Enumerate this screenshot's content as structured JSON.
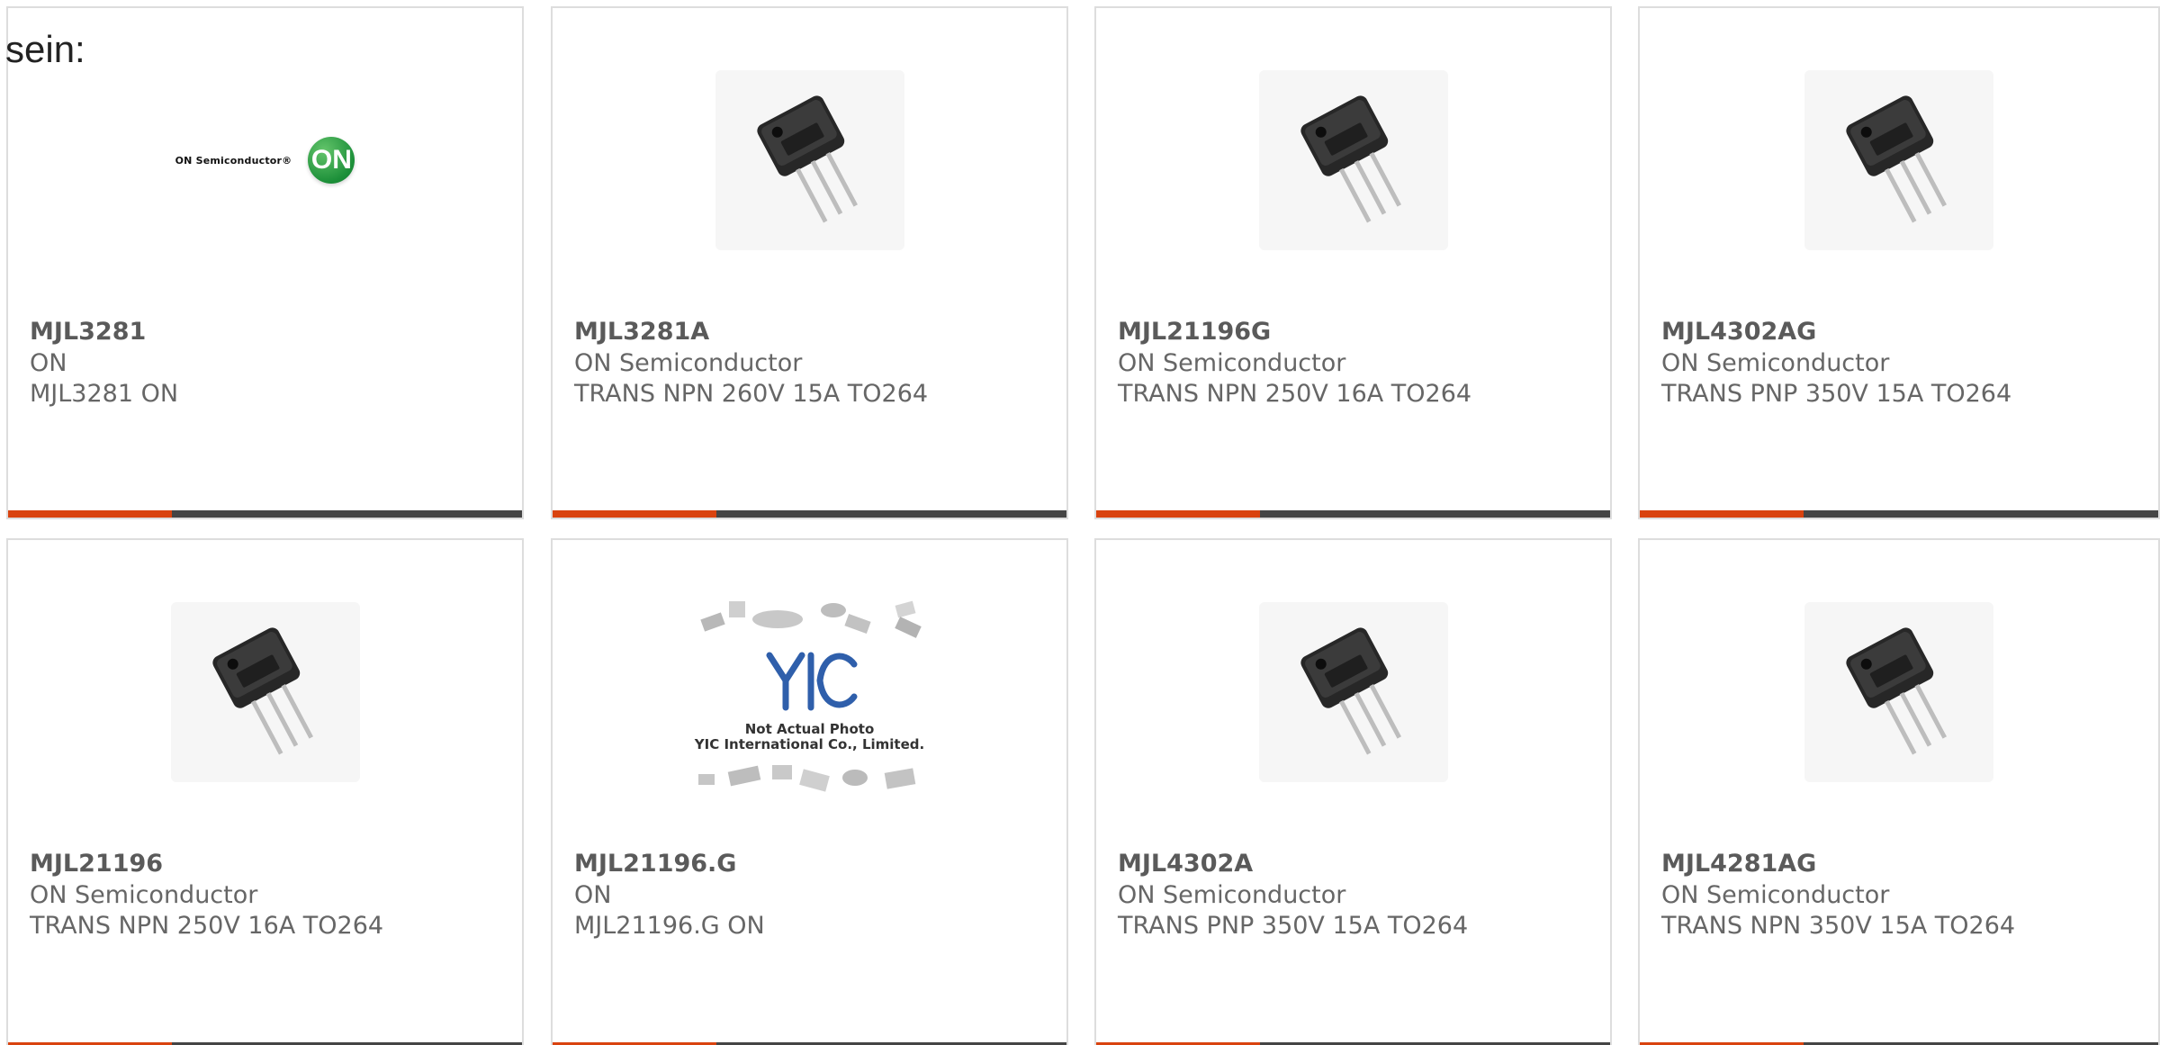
{
  "lead_text": "sein:",
  "colors": {
    "accent_bar": "#d9430f",
    "dark_bar": "#454545",
    "card_border": "#dddddd",
    "on_green": "#1c8f39",
    "yic_blue": "#2f5fab"
  },
  "cards": [
    {
      "part_number": "MJL3281",
      "manufacturer": "ON",
      "description": "MJL3281 ON",
      "thumbnail": "on-semiconductor-logo",
      "logo_text": "ON Semiconductor®",
      "badge_text": "ON"
    },
    {
      "part_number": "MJL3281A",
      "manufacturer": "ON Semiconductor",
      "description": "TRANS NPN 260V 15A TO264",
      "thumbnail": "to264-transistor-icon"
    },
    {
      "part_number": "MJL21196G",
      "manufacturer": "ON Semiconductor",
      "description": "TRANS NPN 250V 16A TO264",
      "thumbnail": "to264-transistor-icon"
    },
    {
      "part_number": "MJL4302AG",
      "manufacturer": "ON Semiconductor",
      "description": "TRANS PNP 350V 15A TO264",
      "thumbnail": "to264-transistor-icon"
    },
    {
      "part_number": "MJL21196",
      "manufacturer": "ON Semiconductor",
      "description": "TRANS NPN 250V 16A TO264",
      "thumbnail": "to264-transistor-icon"
    },
    {
      "part_number": "MJL21196.G",
      "manufacturer": "ON",
      "description": "MJL21196.G ON",
      "thumbnail": "yic-not-actual-photo",
      "caption_line1": "Not Actual Photo",
      "caption_line2": "YIC International Co., Limited."
    },
    {
      "part_number": "MJL4302A",
      "manufacturer": "ON Semiconductor",
      "description": "TRANS PNP 350V 15A TO264",
      "thumbnail": "to264-transistor-icon"
    },
    {
      "part_number": "MJL4281AG",
      "manufacturer": "ON Semiconductor",
      "description": "TRANS NPN 350V 15A TO264",
      "thumbnail": "to264-transistor-icon"
    }
  ]
}
